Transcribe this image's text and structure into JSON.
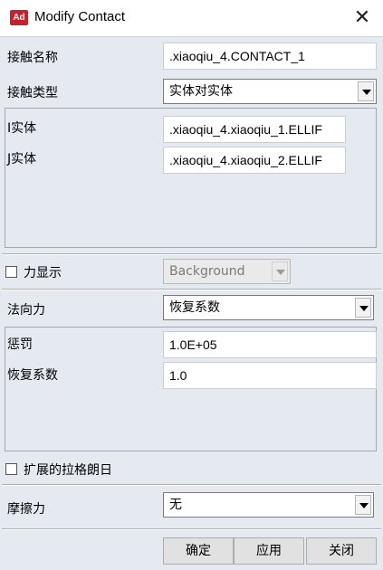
{
  "window": {
    "app_icon_text": "Ad",
    "title": "Modify Contact",
    "close_glyph": "✕"
  },
  "form": {
    "contact_name": {
      "label": "接触名称",
      "value": ".xiaoqiu_4.CONTACT_1"
    },
    "contact_type": {
      "label": "接触类型",
      "value": "实体对实体"
    },
    "i_body": {
      "label": "I实体",
      "value": ".xiaoqiu_4.xiaoqiu_1.ELLIF"
    },
    "j_body": {
      "label": "J实体",
      "value": ".xiaoqiu_4.xiaoqiu_2.ELLIF"
    },
    "force_display": {
      "label": "力显示",
      "checked": false,
      "value": "Background"
    },
    "normal_force": {
      "label": "法向力",
      "value": "恢复系数"
    },
    "penalty": {
      "label": "惩罚",
      "value": "1.0E+05"
    },
    "restitution": {
      "label": "恢复系数",
      "value": "1.0"
    },
    "augmented_lagrangian": {
      "label": "扩展的拉格朗日",
      "checked": false
    },
    "friction": {
      "label": "摩擦力",
      "value": "无"
    }
  },
  "buttons": {
    "ok": "确定",
    "apply": "应用",
    "close": "关闭"
  }
}
